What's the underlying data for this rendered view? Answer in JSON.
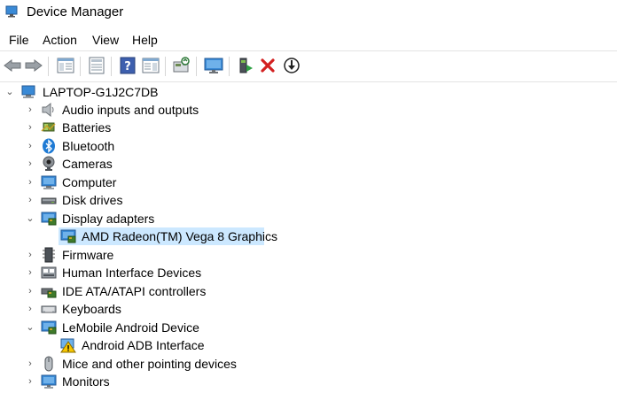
{
  "window": {
    "title": "Device Manager"
  },
  "menu": [
    "File",
    "Action",
    "View",
    "Help"
  ],
  "toolbar": {
    "buttons": [
      "back-icon",
      "forward-icon",
      "show-hide-console-tree-icon",
      "properties-icon",
      "help-icon",
      "action-pane-icon",
      "scan-hardware-icon",
      "monitor-icon",
      "update-driver-icon",
      "uninstall-icon",
      "disable-device-icon"
    ]
  },
  "tree": {
    "root": "LAPTOP-G1J2C7DB",
    "categories": [
      {
        "label": "Audio inputs and outputs",
        "icon": "speaker-icon",
        "expanded": false
      },
      {
        "label": "Batteries",
        "icon": "battery-icon",
        "expanded": false
      },
      {
        "label": "Bluetooth",
        "icon": "bluetooth-icon",
        "expanded": false
      },
      {
        "label": "Cameras",
        "icon": "camera-icon",
        "expanded": false
      },
      {
        "label": "Computer",
        "icon": "computer-icon",
        "expanded": false
      },
      {
        "label": "Disk drives",
        "icon": "disk-drive-icon",
        "expanded": false
      },
      {
        "label": "Display adapters",
        "icon": "display-adapter-icon",
        "expanded": true,
        "children": [
          {
            "label": "AMD Radeon(TM) Vega 8 Graphics",
            "icon": "display-adapter-icon",
            "selected": true
          }
        ]
      },
      {
        "label": "Firmware",
        "icon": "firmware-icon",
        "expanded": false
      },
      {
        "label": "Human Interface Devices",
        "icon": "hid-icon",
        "expanded": false
      },
      {
        "label": "IDE ATA/ATAPI controllers",
        "icon": "ide-controller-icon",
        "expanded": false
      },
      {
        "label": "Keyboards",
        "icon": "keyboard-icon",
        "expanded": false
      },
      {
        "label": "LeMobile Android Device",
        "icon": "android-device-icon",
        "expanded": true,
        "children": [
          {
            "label": "Android ADB Interface",
            "icon": "warning-icon",
            "selected": false
          }
        ]
      },
      {
        "label": "Mice and other pointing devices",
        "icon": "mouse-icon",
        "expanded": false
      },
      {
        "label": "Monitors",
        "icon": "monitor-icon",
        "expanded": false
      }
    ]
  },
  "colors": {
    "selection": "#cce8ff",
    "accent": "#1e7ad4",
    "warning": "#f7c600",
    "uninstall": "#d32020"
  }
}
